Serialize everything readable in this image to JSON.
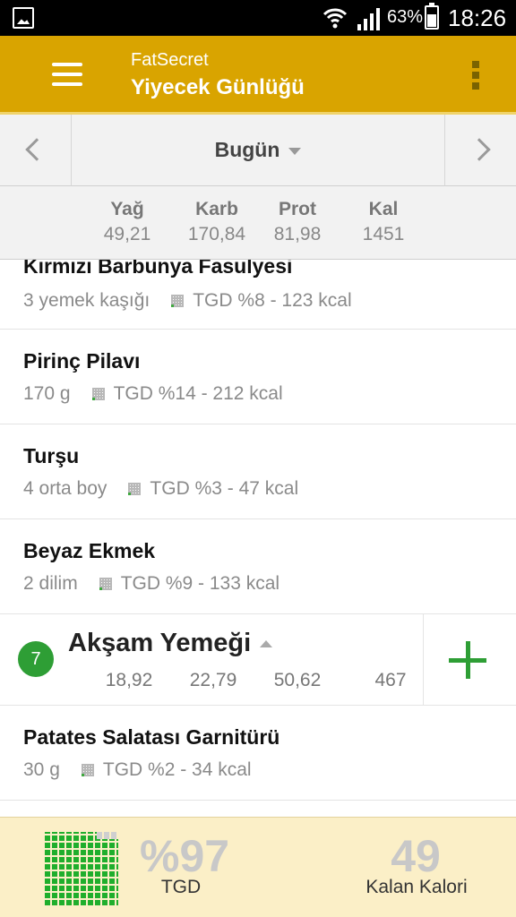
{
  "status_bar": {
    "battery": "63%",
    "time": "18:26"
  },
  "app_bar": {
    "app_name": "FatSecret",
    "title": "Yiyecek Günlüğü"
  },
  "date_nav": {
    "label": "Bugün"
  },
  "macros": {
    "labels": [
      "Yağ",
      "Karb",
      "Prot",
      "Kal"
    ],
    "values": [
      "49,21",
      "170,84",
      "81,98",
      "1451"
    ]
  },
  "foods": [
    {
      "name": "Kırmızı Barbunya Fasulyesi",
      "portion": "3 yemek kaşığı",
      "info": "TGD %8 - 123 kcal"
    },
    {
      "name": "Pirinç Pilavı",
      "portion": "170 g",
      "info": "TGD %14 - 212 kcal"
    },
    {
      "name": "Turşu",
      "portion": "4 orta boy",
      "info": "TGD %3 - 47 kcal"
    },
    {
      "name": "Beyaz Ekmek",
      "portion": "2  dilim",
      "info": "TGD %9 - 133 kcal"
    }
  ],
  "meal": {
    "number": "7",
    "title": "Akşam Yemeği",
    "values": [
      "18,92",
      "22,79",
      "50,62",
      "467"
    ]
  },
  "meal_foods": [
    {
      "name": "Patates Salatası Garnitürü",
      "portion": "30  g",
      "info": "TGD %2 - 34 kcal"
    }
  ],
  "footer": {
    "rdi_percent": "%97",
    "rdi_label": "TGD",
    "remaining_value": "49",
    "remaining_label": "Kalan Kalori"
  },
  "colors": {
    "app_bar": "#d9a400",
    "accent_green": "#2e9e35",
    "footer_bg": "#fbefc7"
  }
}
